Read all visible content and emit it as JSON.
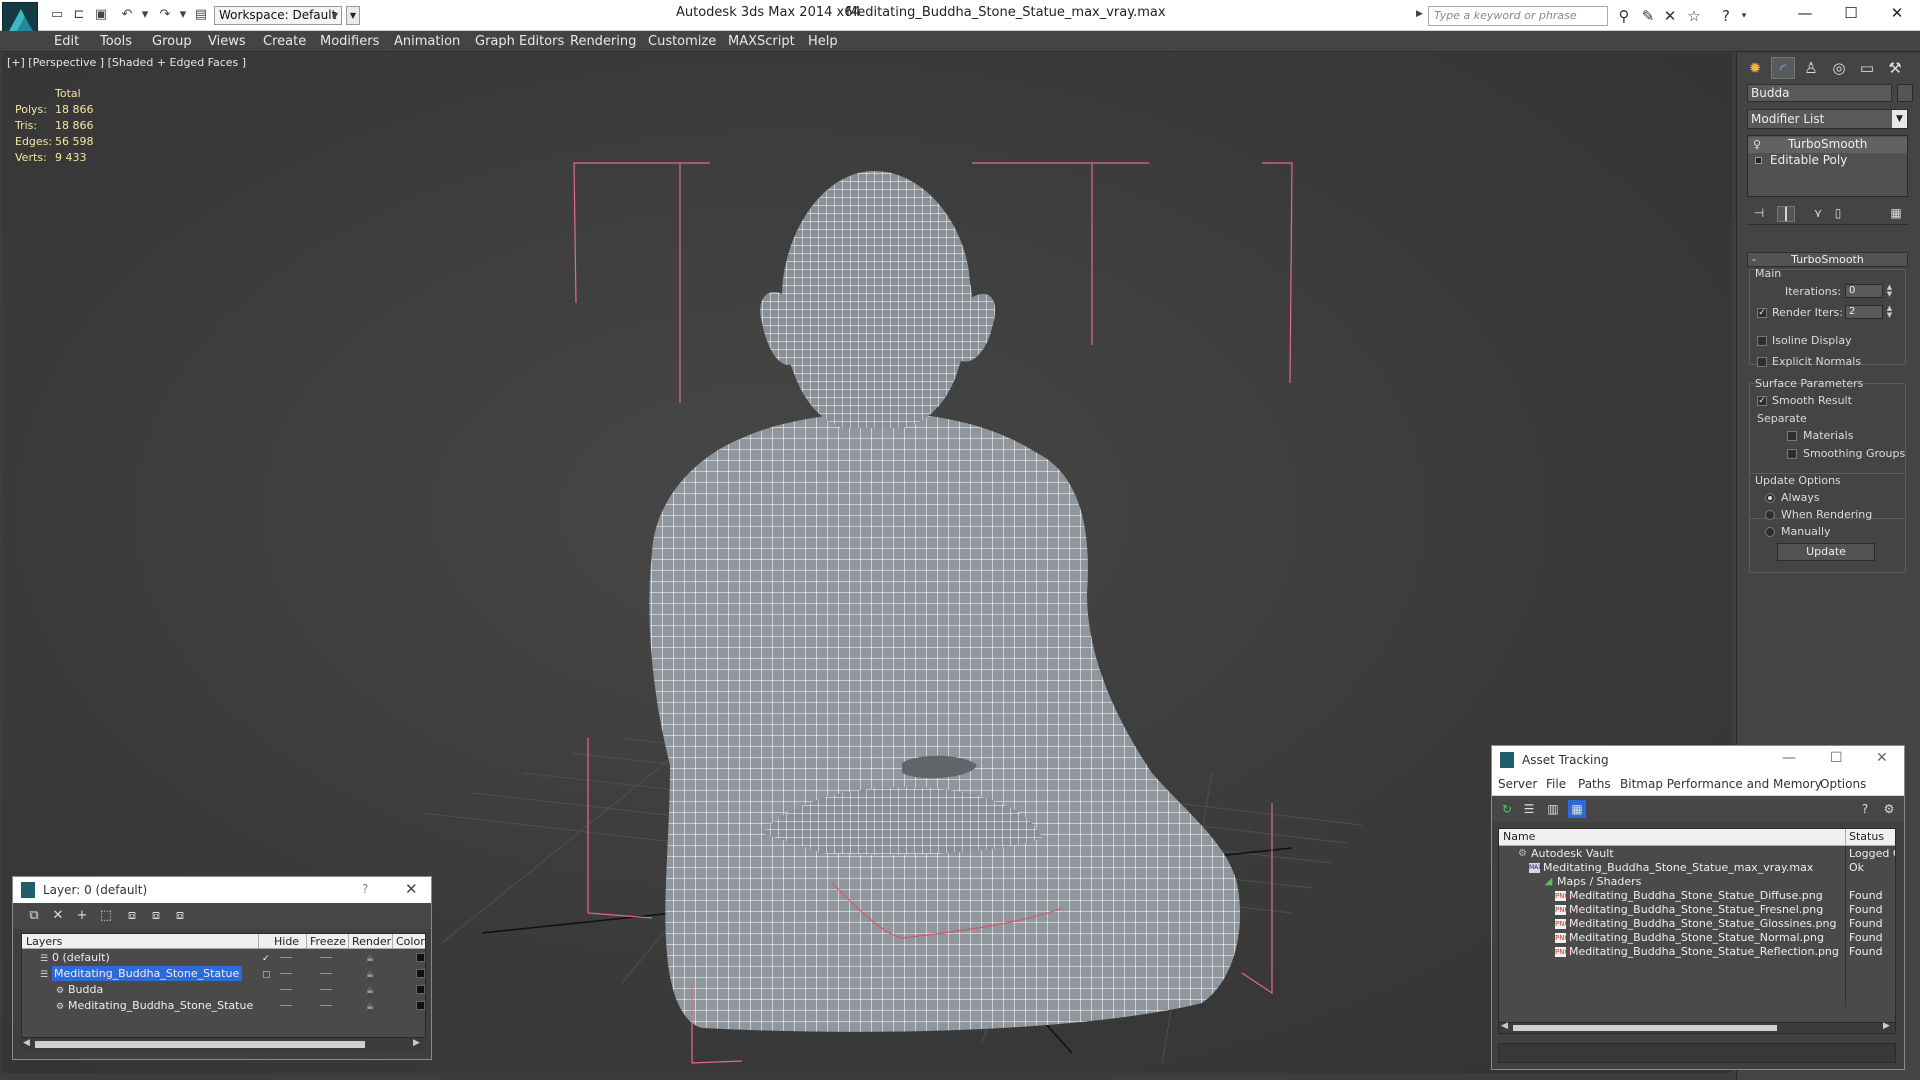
{
  "titlebar": {
    "workspace": "Workspace: Default",
    "app_title": "Autodesk 3ds Max 2014 x64",
    "file_title": "Meditating_Buddha_Stone_Statue_max_vray.max",
    "search_placeholder": "Type a keyword or phrase",
    "minimize": "—",
    "maximize": "☐",
    "close": "✕"
  },
  "menu": [
    "Edit",
    "Tools",
    "Group",
    "Views",
    "Create",
    "Modifiers",
    "Animation",
    "Graph Editors",
    "Rendering",
    "Customize",
    "MAXScript",
    "Help"
  ],
  "viewport": {
    "label": "[+] [Perspective ] [Shaded + Edged Faces ]",
    "stats": {
      "header": "Total",
      "rows": [
        {
          "k": "Polys:",
          "v": "18 866"
        },
        {
          "k": "Tris:",
          "v": "18 866"
        },
        {
          "k": "Edges:",
          "v": "56 598"
        },
        {
          "k": "Verts:",
          "v": "9 433"
        }
      ]
    }
  },
  "command_panel": {
    "object_name": "Budda",
    "modifier_list": "Modifier List",
    "stack": [
      "TurboSmooth",
      "Editable Poly"
    ],
    "rollout": "TurboSmooth",
    "main_label": "Main",
    "iterations_label": "Iterations:",
    "iterations_value": "0",
    "render_iters_label": "Render Iters:",
    "render_iters_value": "2",
    "isoline": "Isoline Display",
    "explicit_normals": "Explicit Normals",
    "surface_params": "Surface Parameters",
    "smooth_result": "Smooth Result",
    "separate": "Separate",
    "materials": "Materials",
    "smoothing_groups": "Smoothing Groups",
    "update_options": "Update Options",
    "always": "Always",
    "when_rendering": "When Rendering",
    "manually": "Manually",
    "update_button": "Update",
    "check_mark": "✓"
  },
  "asset_tracking": {
    "title": "Asset Tracking",
    "menu": [
      "Server",
      "File",
      "Paths",
      "Bitmap Performance and Memory",
      "Options"
    ],
    "col_name": "Name",
    "col_status": "Status",
    "rows": [
      {
        "name": "Autodesk Vault",
        "status": "Logged O",
        "indent": 0
      },
      {
        "name": "Meditating_Buddha_Stone_Statue_max_vray.max",
        "status": "Ok",
        "indent": 1
      },
      {
        "name": "Maps / Shaders",
        "status": "",
        "indent": 2
      },
      {
        "name": "Meditating_Buddha_Stone_Statue_Diffuse.png",
        "status": "Found",
        "indent": 3
      },
      {
        "name": "Meditating_Buddha_Stone_Statue_Fresnel.png",
        "status": "Found",
        "indent": 3
      },
      {
        "name": "Meditating_Buddha_Stone_Statue_Glossines.png",
        "status": "Found",
        "indent": 3
      },
      {
        "name": "Meditating_Buddha_Stone_Statue_Normal.png",
        "status": "Found",
        "indent": 3
      },
      {
        "name": "Meditating_Buddha_Stone_Statue_Reflection.png",
        "status": "Found",
        "indent": 3
      }
    ],
    "png_badge": "PNG"
  },
  "layer_manager": {
    "title": "Layer: 0 (default)",
    "help": "?",
    "close": "✕",
    "cols": [
      "Layers",
      "Hide",
      "Freeze",
      "Render",
      "Color"
    ],
    "rows": [
      {
        "name": "0 (default)",
        "indent": 0,
        "selected": false,
        "current": true
      },
      {
        "name": "Meditating_Buddha_Stone_Statue",
        "indent": 0,
        "selected": true,
        "current": false
      },
      {
        "name": "Budda",
        "indent": 1,
        "selected": false,
        "current": false
      },
      {
        "name": "Meditating_Buddha_Stone_Statue",
        "indent": 1,
        "selected": false,
        "current": false
      }
    ]
  },
  "colors": {
    "viewport_bg": "#3d3d3d",
    "stats_text": "#f2e79a",
    "selection": "#2f6bd6",
    "bbox_corners": "#e06b8a",
    "wireframe": "#ffffff"
  }
}
